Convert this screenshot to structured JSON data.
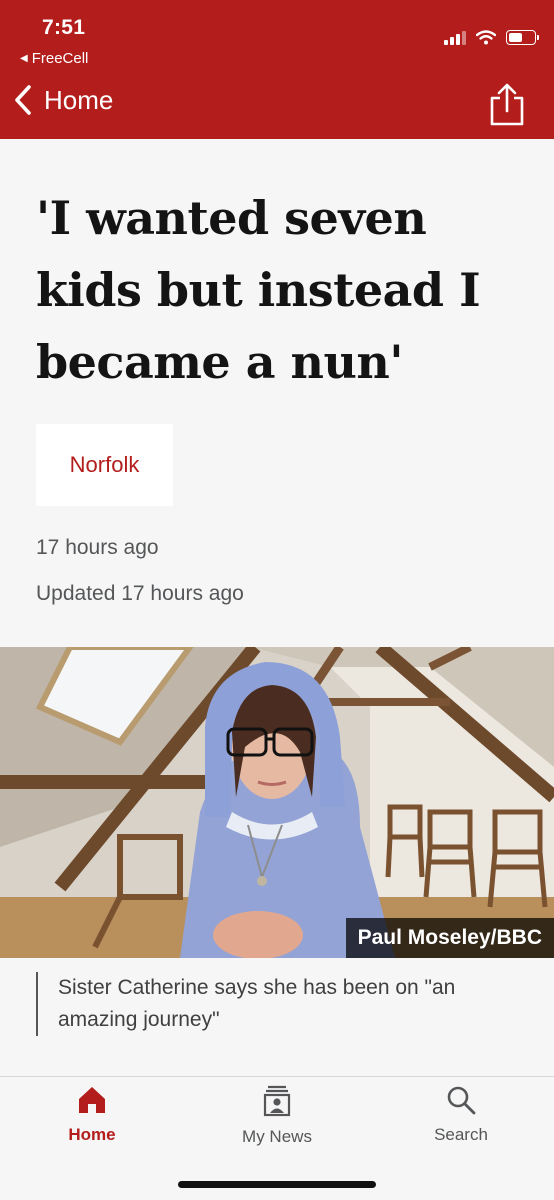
{
  "status_bar": {
    "time": "7:51",
    "back_app": "FreeCell",
    "back_app_icon": "left-triangle-icon",
    "signal_icon": "cellular-signal-icon",
    "wifi_icon": "wifi-icon",
    "battery_icon": "battery-icon"
  },
  "nav": {
    "back_label": "Home",
    "back_icon": "chevron-left-icon",
    "share_icon": "share-icon"
  },
  "article": {
    "headline": "'I wanted seven kids but instead I became a nun'",
    "tag": "Norfolk",
    "published": "17 hours ago",
    "updated": "Updated 17 hours ago",
    "image": {
      "credit": "Paul Moseley/BBC",
      "caption": "Sister Catherine says she has been on \"an amazing journey\""
    }
  },
  "tabbar": {
    "tabs": [
      {
        "label": "Home",
        "icon": "home-icon",
        "active": true
      },
      {
        "label": "My News",
        "icon": "my-news-icon",
        "active": false
      },
      {
        "label": "Search",
        "icon": "search-icon",
        "active": false
      }
    ]
  },
  "colors": {
    "brand_red": "#b31e1c",
    "background": "#f6f6f6",
    "text": "#141414",
    "muted_text": "#545658"
  }
}
